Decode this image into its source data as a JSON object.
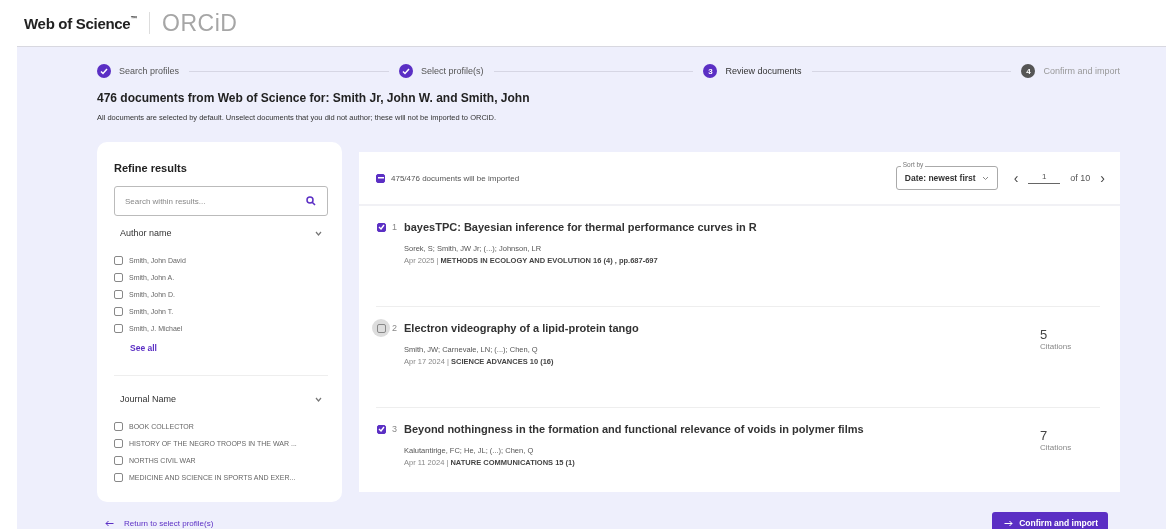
{
  "header": {
    "brand": "Web of Science",
    "brand_mark": "™",
    "partner": "ORCiD"
  },
  "steps": [
    {
      "label": "Search profiles",
      "completed": true
    },
    {
      "label": "Select profile(s)",
      "completed": true
    },
    {
      "label": "Review documents",
      "completed": false,
      "current": true,
      "number": "3"
    },
    {
      "label": "Confirm and import",
      "completed": false,
      "current": false,
      "number": "4"
    }
  ],
  "heading": "476 documents from Web of Science for: Smith Jr, John W. and Smith, John",
  "subheading": "All documents are selected by default. Unselect documents that you did not author; these will not be imported to ORCiD.",
  "refine": {
    "title": "Refine results",
    "search": {
      "placeholder": "Search within results..."
    },
    "groups": [
      {
        "title": "Author name",
        "expanded": true,
        "items": [
          {
            "label": "Smith, John David",
            "checked": false
          },
          {
            "label": "Smith, John A.",
            "checked": false
          },
          {
            "label": "Smith, John D.",
            "checked": false
          },
          {
            "label": "Smith, John T.",
            "checked": false
          },
          {
            "label": "Smith, J. Michael",
            "checked": false
          }
        ],
        "see_all": "See all"
      },
      {
        "title": "Journal Name",
        "expanded": true,
        "items": [
          {
            "label": "BOOK COLLECTOR",
            "checked": false
          },
          {
            "label": "HISTORY OF THE NEGRO TROOPS IN THE WAR ...",
            "checked": false
          },
          {
            "label": "NORTHS CIVIL WAR",
            "checked": false
          },
          {
            "label": "MEDICINE AND SCIENCE IN SPORTS AND EXER...",
            "checked": false
          }
        ]
      }
    ]
  },
  "results": {
    "select_all": {
      "label": "475/476 documents will be imported",
      "indeterminate": true
    },
    "sort": {
      "label": "Sort by",
      "value": "Date: newest first"
    },
    "pagination": {
      "prev": "‹",
      "page": "1",
      "of": "of 10",
      "next": "›"
    },
    "documents": [
      {
        "checked": true,
        "focused": false,
        "index": "1",
        "title": "bayesTPC: Bayesian inference for thermal performance curves in R",
        "authors": "Sorek, S; Smith, JW Jr; (...); Johnson, LR",
        "date": "Apr 2025",
        "separator": "|",
        "source": "METHODS IN ECOLOGY AND EVOLUTION 16 (4) , pp.687-697"
      },
      {
        "checked": false,
        "focused": true,
        "index": "2",
        "title": "Electron videography of a lipid-protein tango",
        "authors": "Smith, JW; Carnevale, LN; (...); Chen, Q",
        "date": "Apr 17 2024",
        "separator": "|",
        "source": "SCIENCE ADVANCES 10 (16)",
        "citations": "5",
        "citations_label": "Citations"
      },
      {
        "checked": true,
        "focused": false,
        "index": "3",
        "title": "Beyond nothingness in the formation and functional relevance of voids in polymer films",
        "authors": "Kalutantirige, FC; He, JL; (...); Chen, Q",
        "date": "Apr 11 2024",
        "separator": "|",
        "source": "NATURE COMMUNICATIONS 15 (1)",
        "citations": "7",
        "citations_label": "Citations"
      }
    ]
  },
  "footer": {
    "back": "Return to select profile(s)",
    "confirm": "Confirm and import"
  }
}
